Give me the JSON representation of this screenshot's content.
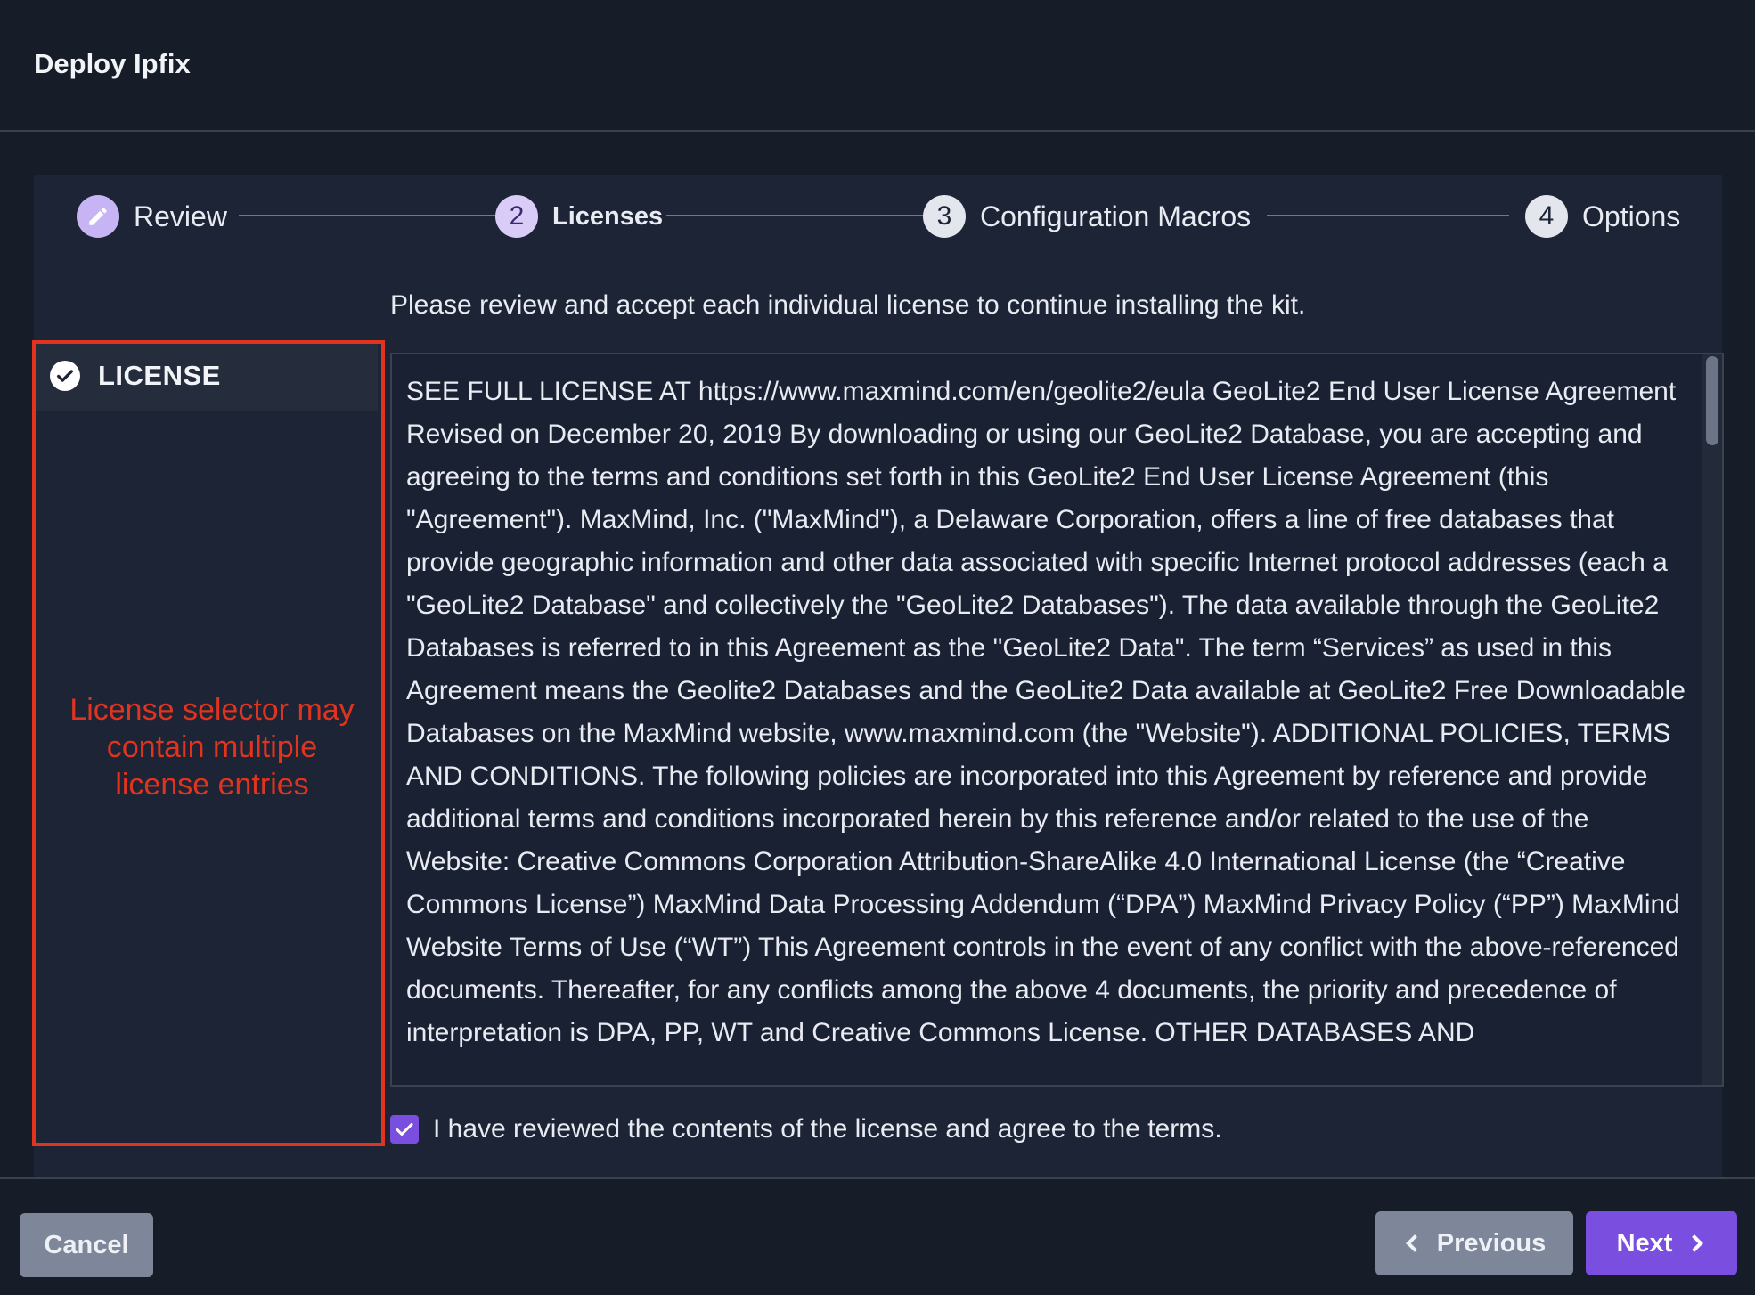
{
  "header": {
    "title": "Deploy Ipfix"
  },
  "stepper": {
    "steps": [
      {
        "number": "",
        "label": "Review",
        "state": "done",
        "icon": "pencil-icon"
      },
      {
        "number": "2",
        "label": "Licenses",
        "state": "active"
      },
      {
        "number": "3",
        "label": "Configuration Macros",
        "state": "todo"
      },
      {
        "number": "4",
        "label": "Options",
        "state": "todo"
      }
    ]
  },
  "main": {
    "instructions": "Please review and accept each individual license to continue installing the kit.",
    "license_selector": {
      "items": [
        {
          "label": "LICENSE",
          "icon": "check-circle-icon",
          "accepted": true
        }
      ]
    },
    "annotation": "License selector may contain multiple license entries",
    "license_text": "SEE FULL LICENSE AT https://www.maxmind.com/en/geolite2/eula GeoLite2 End User License Agreement Revised on December 20, 2019 By downloading or using our GeoLite2 Database, you are accepting and agreeing to the terms and conditions set forth in this GeoLite2 End User License Agreement (this \"Agreement\"). MaxMind, Inc. (\"MaxMind\"), a Delaware Corporation, offers a line of free databases that provide geographic information and other data associated with specific Internet protocol addresses (each a \"GeoLite2 Database\" and collectively the \"GeoLite2 Databases\"). The data available through the GeoLite2 Databases is referred to in this Agreement as the \"GeoLite2 Data\". The term “Services” as used in this Agreement means the Geolite2 Databases and the GeoLite2 Data available at GeoLite2 Free Downloadable Databases on the MaxMind website, www.maxmind.com (the \"Website\"). ADDITIONAL POLICIES, TERMS AND CONDITIONS. The following policies are incorporated into this Agreement by reference and provide additional terms and conditions incorporated herein by this reference and/or related to the use of the Website: Creative Commons Corporation Attribution-ShareAlike 4.0 International License (the “Creative Commons License”) MaxMind Data Processing Addendum (“DPA”) MaxMind Privacy Policy (“PP”) MaxMind Website Terms of Use (“WT”) This Agreement controls in the event of any conflict with the above-referenced documents. Thereafter, for any conflicts among the above 4 documents, the priority and precedence of interpretation is DPA, PP, WT and Creative Commons License. OTHER DATABASES AND",
    "agree": {
      "label": "I have reviewed the contents of the license and agree to the terms.",
      "checked": true
    }
  },
  "footer": {
    "cancel_label": "Cancel",
    "previous_label": "Previous",
    "next_label": "Next"
  },
  "colors": {
    "accent": "#7a4fe0",
    "annotation": "#e0341f",
    "background": "#161c28"
  }
}
